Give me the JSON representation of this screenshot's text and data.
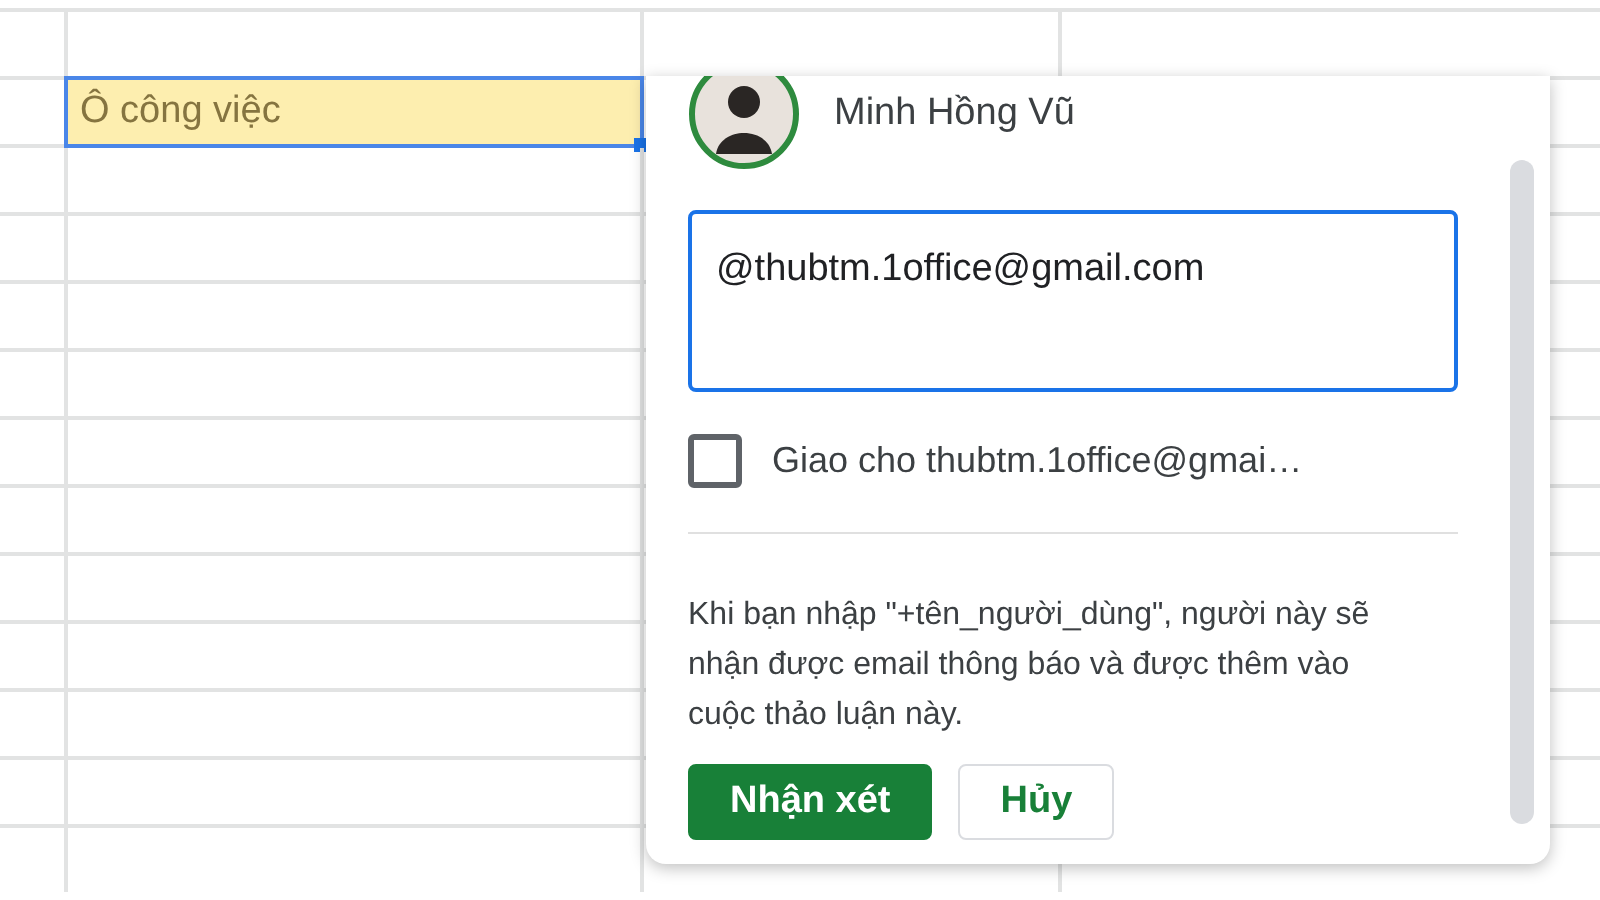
{
  "sheet": {
    "cell": {
      "text": "Ô công việc",
      "selected": true
    }
  },
  "comment_popup": {
    "author": "Minh Hồng Vũ",
    "input": {
      "value": "@thubtm.1office@gmail.com"
    },
    "assign": {
      "label": "Giao cho thubtm.1office@gmai…",
      "checked": false
    },
    "hint": "Khi bạn nhập \"+tên_người_dùng\", người này sẽ nhận được email thông báo và được thêm vào cuộc thảo luận này.",
    "buttons": [
      {
        "label": "Nhận xét",
        "kind": "primary"
      },
      {
        "label": "Hủy",
        "kind": "secondary"
      }
    ]
  }
}
